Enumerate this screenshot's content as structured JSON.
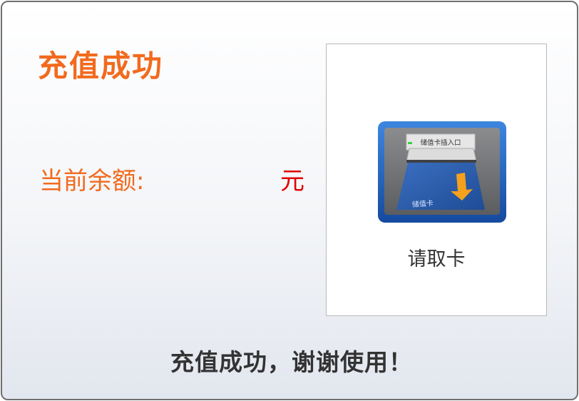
{
  "title": "充值成功",
  "balance": {
    "label": "当前余额:",
    "value": "",
    "unit": "元"
  },
  "card_panel": {
    "slot_label": "储值卡插入口",
    "card_label": "储值卡",
    "prompt": "请取卡"
  },
  "footer_message": "充值成功，谢谢使用！",
  "colors": {
    "title": "#f26a1d",
    "balance_label": "#f26a1d",
    "balance_unit": "#e00000",
    "frame_blue": "#1e5fc4",
    "card_blue": "#2c5aa8",
    "arrow_orange": "#f5a11c"
  }
}
